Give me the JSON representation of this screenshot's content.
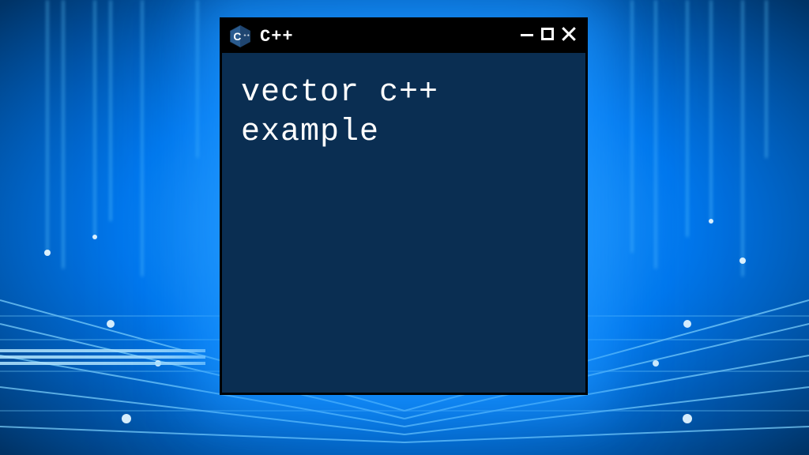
{
  "window": {
    "title": "C++",
    "icon_letter": "C",
    "icon_plus": "++"
  },
  "content": {
    "text": "vector c++\nexample"
  },
  "colors": {
    "window_bg": "#0a2e52",
    "titlebar_bg": "#000000",
    "text": "#ffffff",
    "glow": "#1e96ff"
  }
}
